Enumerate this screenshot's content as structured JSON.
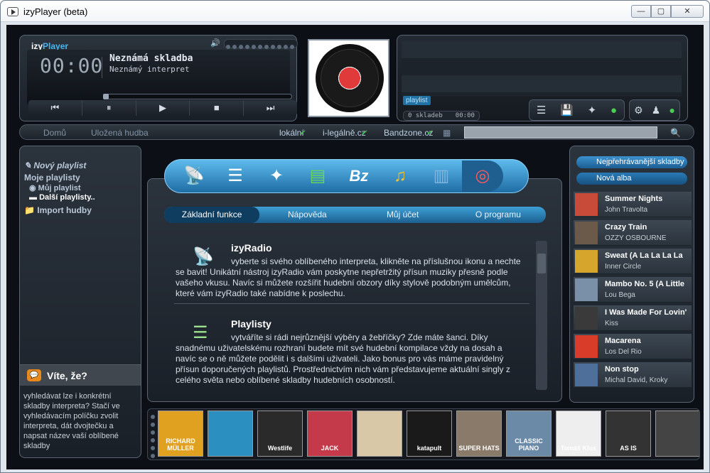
{
  "window": {
    "title": "izyPlayer (beta)",
    "min": "—",
    "max": "▢",
    "close": "✕"
  },
  "player": {
    "brand1": "izy",
    "brand2": "Player",
    "time": "00:00",
    "track": "Neznámá skladba",
    "artist": "Neznámý interpret",
    "progress": 0,
    "controls": [
      "⏮",
      "⏸",
      "▶",
      "■",
      "⏭"
    ]
  },
  "playlist": {
    "tag": "playlist",
    "count": "0 skladeb",
    "duration": "00:00"
  },
  "nav": {
    "home": "Domů",
    "saved": "Uložená hudba",
    "local": "lokální",
    "ilegalne": "i-legálně.cz",
    "bandzone": "Bandzone.cz",
    "search_placeholder": ""
  },
  "left": {
    "new_playlist": "Nový playlist",
    "my_playlists": "Moje playlisty",
    "my_playlist": "Můj playlist",
    "other_playlists": "Další playlisty..",
    "import": "Import hudby",
    "tip_title": "Víte, že?",
    "tip_text": "vyhledávat lze i konkrétní skladby interpreta? Stačí ve vyhledávacím políčku zvolit interpreta, dát dvojtečku a napsat název vaší oblíbené skladby"
  },
  "tabs": {
    "icons": [
      "antenna-icon",
      "list-icon",
      "magic-wand-icon",
      "radio-icon",
      "bz-icon",
      "music-note-icon",
      "equalizer-icon",
      "lifebuoy-icon"
    ],
    "sub": [
      "Základní funkce",
      "Nápověda",
      "Můj účet",
      "O programu"
    ]
  },
  "content": [
    {
      "title": "izyRadio",
      "text": "vyberte si svého oblíbeného interpreta, klikněte na příslušnou ikonu a nechte se bavit! Unikátní nástroj izyRadio vám poskytne nepřetržitý přísun muziky přesně podle vašeho vkusu. Navíc si můžete rozšířit hudební obzory díky stylově podobným umělcům, které vám izyRadio také nabídne k poslechu."
    },
    {
      "title": "Playlisty",
      "text": "vytváříte si rádi nejrůznější výběry a žebříčky? Zde máte šanci. Díky snadnému uživatelskému rozhraní budete mít své hudební kompilace vždy na dosah a navíc se o ně můžete podělit i s dalšími uživateli. Jako bonus pro vás máme pravidelný přísun doporučených playlistů. Prostřednictvím nich vám představujeme aktuální singly z celého světa nebo oblíbené skladby hudebních osobností."
    }
  ],
  "right": {
    "top_songs": "Nejpřehrávanější skladby",
    "new_albums": "Nová alba",
    "songs": [
      {
        "name": "Summer Nights",
        "artist": "John Travolta",
        "color": "#c84b3a"
      },
      {
        "name": "Crazy Train",
        "artist": "OZZY OSBOURNE",
        "color": "#6b5a4a"
      },
      {
        "name": "Sweat (A La La La La",
        "artist": "Inner Circle",
        "color": "#d6a52b"
      },
      {
        "name": "Mambo No. 5 (A Little",
        "artist": "Lou Bega",
        "color": "#7a8fa8"
      },
      {
        "name": "I Was Made For Lovin'",
        "artist": "Kiss",
        "color": "#3a3a3a"
      },
      {
        "name": "Macarena",
        "artist": "Los Del Rio",
        "color": "#d93d2a"
      },
      {
        "name": "Non stop",
        "artist": "Michal David, Kroky",
        "color": "#4e6f9a"
      }
    ]
  },
  "albums": [
    {
      "label": "RICHARD MÜLLER",
      "color": "#e0a020"
    },
    {
      "label": "",
      "color": "#2b8fc0"
    },
    {
      "label": "Westlife",
      "color": "#2a2a2a"
    },
    {
      "label": "JACK",
      "color": "#c43a4a"
    },
    {
      "label": "",
      "color": "#d8c8a8"
    },
    {
      "label": "katapult",
      "color": "#1a1a1a"
    },
    {
      "label": "SUPER HATS",
      "color": "#8a7a6a"
    },
    {
      "label": "CLASSIC PIANO",
      "color": "#6a8aa8"
    },
    {
      "label": "Tomáš Klus",
      "color": "#eeeeee"
    },
    {
      "label": "AS IS",
      "color": "#333333"
    },
    {
      "label": "",
      "color": "#444444"
    }
  ]
}
